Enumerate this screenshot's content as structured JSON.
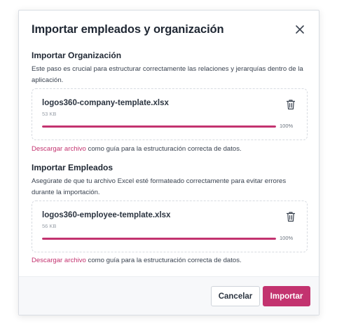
{
  "dialog": {
    "title": "Importar empleados y organización"
  },
  "organization": {
    "title": "Importar Organización",
    "description": "Este paso es crucial para estructurar correctamente las relaciones y jerarquías dentro de la aplicación.",
    "file": {
      "name": "logos360-company-template.xlsx",
      "size": "53 KB",
      "progress": 100,
      "progress_label": "100%"
    },
    "hint_link": "Descargar archivo",
    "hint_text": " como guía para la estructuración correcta de datos."
  },
  "employees": {
    "title": "Importar Empleados",
    "description": "Asegúrate de que tu archivo Excel esté formateado correctamente para evitar errores durante la importación.",
    "file": {
      "name": "logos360-employee-template.xlsx",
      "size": "56 KB",
      "progress": 100,
      "progress_label": "100%"
    },
    "hint_link": "Descargar archivo",
    "hint_text": " como guía para la estructuración correcta de datos."
  },
  "footer": {
    "cancel_label": "Cancelar",
    "import_label": "Importar"
  },
  "colors": {
    "accent": "#c3336f",
    "progress_track": "#f3d3e2"
  },
  "icons": {
    "close": "close-icon",
    "delete": "trash-icon"
  }
}
